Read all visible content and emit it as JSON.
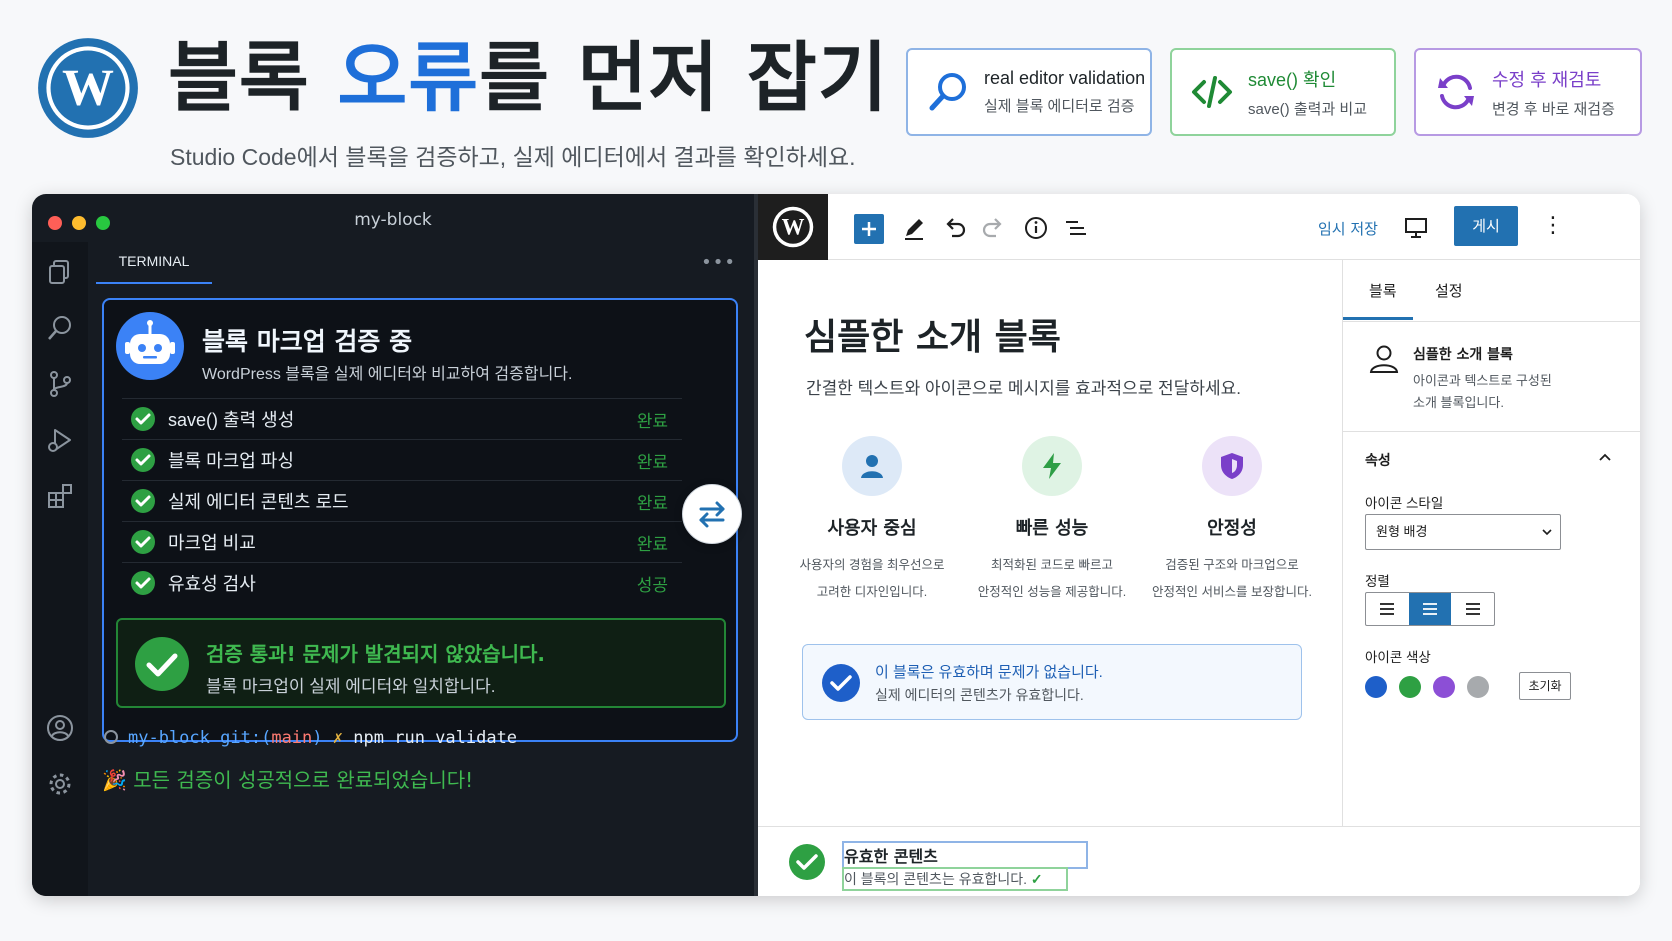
{
  "header": {
    "title_part1": "블록 ",
    "title_highlight": "오류",
    "title_part2": "를 먼저 잡기",
    "subtitle": "Studio Code에서 블록을 검증하고, 실제 에디터에서 결과를 확인하세요.",
    "features": [
      {
        "title": "real editor validation",
        "desc": "실제 블록 에디터로 검증",
        "icon": "search-icon",
        "color": "#1e6fd9"
      },
      {
        "title": "save() 확인",
        "desc": "save() 출력과 비교",
        "icon": "code-icon",
        "color": "#1f8a35"
      },
      {
        "title": "수정 후 재검토",
        "desc": "변경 후 바로 재검증",
        "icon": "refresh-icon",
        "color": "#7a3fc9"
      }
    ]
  },
  "vscode": {
    "window_title": "my-block",
    "tab": "TERMINAL",
    "panel": {
      "title": "블록 마크업 검증 중",
      "subtitle": "WordPress 블록을 실제 에디터와 비교하여 검증합니다.",
      "steps": [
        {
          "label": "save() 출력 생성",
          "status": "완료"
        },
        {
          "label": "블록 마크업 파싱",
          "status": "완료"
        },
        {
          "label": "실제 에디터 콘텐츠 로드",
          "status": "완료"
        },
        {
          "label": "마크업 비교",
          "status": "완료"
        },
        {
          "label": "유효성 검사",
          "status": "성공"
        }
      ],
      "pass_title": "검증 통과! 문제가 발견되지 않았습니다.",
      "pass_desc": "블록 마크업이 실제 에디터와 일치합니다."
    },
    "prompt": {
      "dir": "my-block",
      "git": "git:(",
      "branch": "main",
      "git_close": ")",
      "mark": "✗",
      "command": "npm run validate"
    },
    "done_message": "🎉 모든 검증이 성공적으로 완료되었습니다!"
  },
  "wp": {
    "toolbar": {
      "save_draft": "임시 저장",
      "publish": "게시"
    },
    "canvas": {
      "title": "심플한 소개 블록",
      "lead": "간결한 텍스트와 아이콘으로 메시지를 효과적으로 전달하세요.",
      "features": [
        {
          "title": "사용자 중심",
          "d1": "사용자의 경험을 최우선으로",
          "d2": "고려한 디자인입니다.",
          "icon": "user-icon",
          "color": "#2271b1",
          "bg": "#dde9f7"
        },
        {
          "title": "빠른 성능",
          "d1": "최적화된 코드로 빠르고",
          "d2": "안정적인 성능을 제공합니다.",
          "icon": "bolt-icon",
          "color": "#2e9e46",
          "bg": "#dff3e4"
        },
        {
          "title": "안정성",
          "d1": "검증된 구조와 마크업으로",
          "d2": "안정적인 서비스를 보장합니다.",
          "icon": "shield-icon",
          "color": "#7a3fc9",
          "bg": "#ece2f8"
        }
      ],
      "notice_title": "이 블록은 유효하며 문제가 없습니다.",
      "notice_desc": "실제 에디터의 콘텐츠가 유효합니다."
    },
    "sidebar": {
      "tabs": [
        "블록",
        "설정"
      ],
      "block_title": "심플한 소개 블록",
      "block_desc1": "아이콘과 텍스트로 구성된",
      "block_desc2": "소개 블록입니다.",
      "props_head": "속성",
      "icon_style_label": "아이콘 스타일",
      "icon_style_value": "원형 배경",
      "align_label": "정렬",
      "align_active": "center",
      "color_label": "아이콘 색상",
      "colors": [
        "#1e5fc9",
        "#2ea043",
        "#8c4fd6",
        "#a7aaad"
      ],
      "reset": "초기화"
    },
    "footer": {
      "title": "유효한 콘텐츠",
      "desc": "이 블록의 콘텐츠는 유효합니다."
    }
  }
}
